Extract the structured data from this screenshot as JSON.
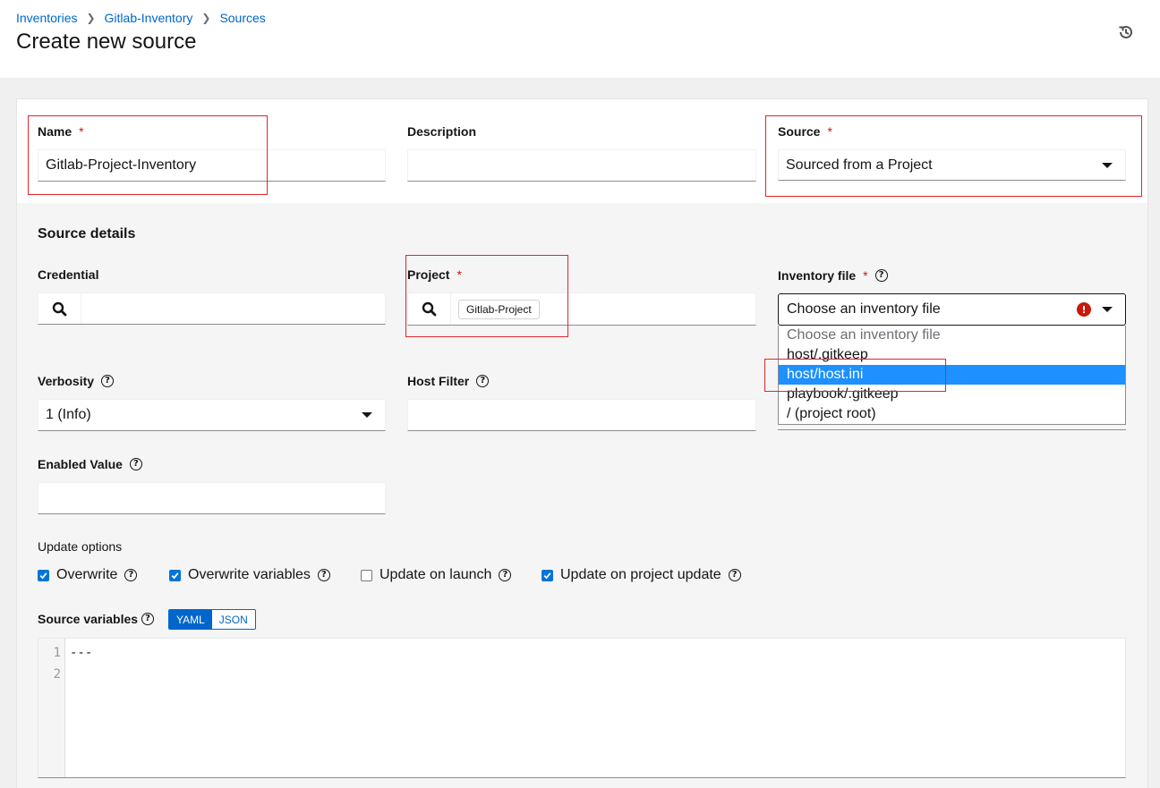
{
  "breadcrumb": [
    "Inventories",
    "Gitlab-Inventory",
    "Sources"
  ],
  "page_title": "Create new source",
  "form": {
    "name_label": "Name",
    "name_value": "Gitlab-Project-Inventory",
    "description_label": "Description",
    "description_value": "",
    "source_label": "Source",
    "source_value": "Sourced from a Project",
    "required_mark": "*"
  },
  "source_details": {
    "title": "Source details",
    "credential_label": "Credential",
    "project_label": "Project",
    "project_chip": "Gitlab-Project",
    "inventory_file_label": "Inventory file",
    "inventory_file_value": "Choose an inventory file",
    "inventory_options": [
      "Choose an inventory file",
      "host/.gitkeep",
      "host/host.ini",
      "playbook/.gitkeep",
      "/ (project root)"
    ],
    "selected_option": "host/host.ini",
    "verbosity_label": "Verbosity",
    "verbosity_value": "1 (Info)",
    "host_filter_label": "Host Filter",
    "enabled_value_label": "Enabled Value"
  },
  "update_options": {
    "title": "Update options",
    "items": [
      {
        "label": "Overwrite",
        "checked": true
      },
      {
        "label": "Overwrite variables",
        "checked": true
      },
      {
        "label": "Update on launch",
        "checked": false
      },
      {
        "label": "Update on project update",
        "checked": true
      }
    ]
  },
  "source_variables": {
    "label": "Source variables",
    "yaml": "YAML",
    "json": "JSON",
    "line_numbers": [
      "1",
      "2"
    ],
    "lines": [
      "---",
      ""
    ]
  },
  "icons": {
    "history": "history-icon",
    "help": "?",
    "error": "!"
  },
  "colors": {
    "link": "#0066cc",
    "selected_option": "#1e90ff",
    "required": "#c9190b",
    "highlight": "#e0262e"
  }
}
